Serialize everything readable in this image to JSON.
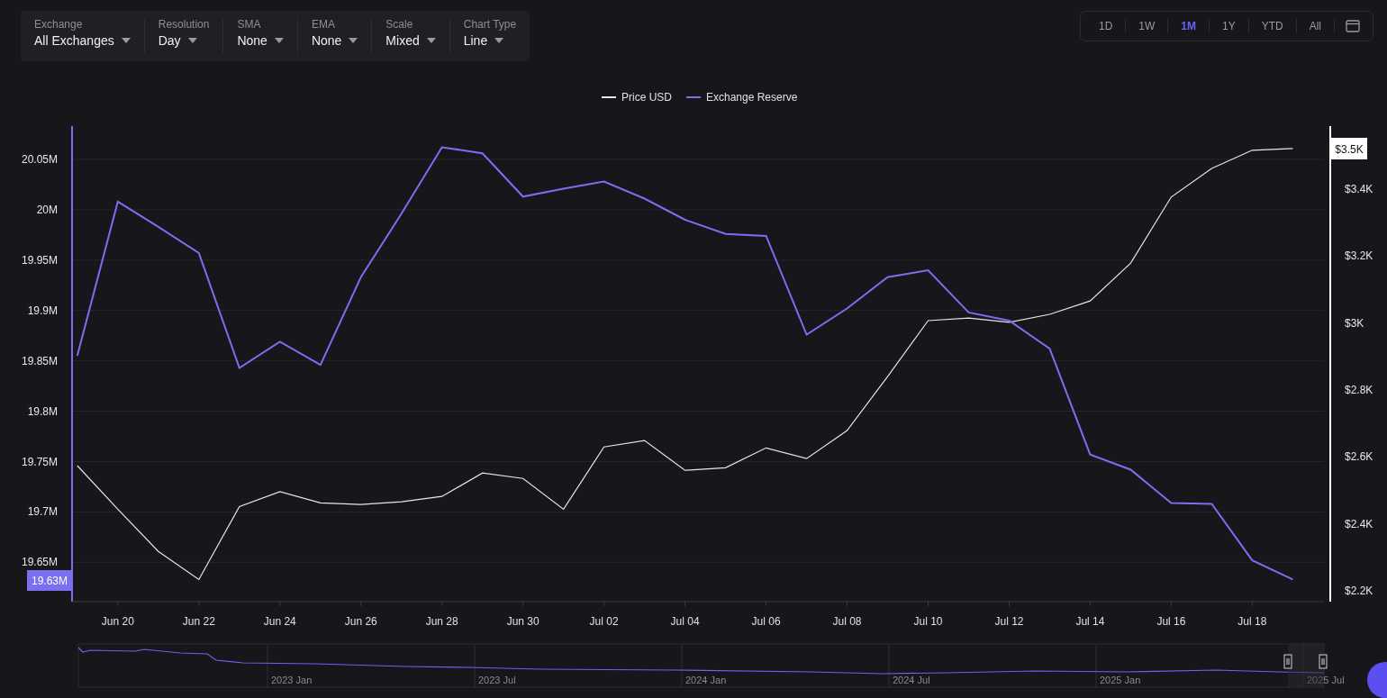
{
  "filters": [
    {
      "label": "Exchange",
      "value": "All Exchanges"
    },
    {
      "label": "Resolution",
      "value": "Day"
    },
    {
      "label": "SMA",
      "value": "None"
    },
    {
      "label": "EMA",
      "value": "None"
    },
    {
      "label": "Scale",
      "value": "Mixed"
    },
    {
      "label": "Chart Type",
      "value": "Line"
    }
  ],
  "ranges": [
    {
      "label": "1D",
      "selected": false
    },
    {
      "label": "1W",
      "selected": false
    },
    {
      "label": "1M",
      "selected": true
    },
    {
      "label": "1Y",
      "selected": false
    },
    {
      "label": "YTD",
      "selected": false
    },
    {
      "label": "All",
      "selected": false
    }
  ],
  "chart": {
    "chart_data": {
      "type": "line",
      "grid": true,
      "legend": "top",
      "categories": [
        null,
        "Jun 20",
        null,
        "Jun 22",
        null,
        "Jun 24",
        null,
        "Jun 26",
        null,
        "Jun 28",
        null,
        "Jun 30",
        null,
        "Jul 02",
        null,
        "Jul 04",
        null,
        "Jul 06",
        null,
        "Jul 08",
        null,
        "Jul 10",
        null,
        "Jul 12",
        null,
        "Jul 14",
        null,
        "Jul 16",
        null,
        "Jul 18",
        null
      ],
      "series": [
        {
          "name": "Price USD",
          "color": "#e6e6e6",
          "axis": "y2",
          "values": [
            2574,
            2444,
            2318,
            2234,
            2452,
            2496,
            2463,
            2458,
            2466,
            2482,
            2552,
            2536,
            2444,
            2630,
            2649,
            2560,
            2568,
            2627,
            2595,
            2679,
            2840,
            3007,
            3015,
            3002,
            3026,
            3066,
            3179,
            3376,
            3462,
            3516,
            3521
          ]
        },
        {
          "name": "Exchange Reserve",
          "color": "#7b6ff0",
          "values": [
            19.855,
            20.008,
            19.983,
            19.957,
            19.843,
            19.869,
            19.846,
            19.933,
            19.996,
            20.062,
            20.056,
            20.013,
            20.021,
            20.028,
            20.011,
            19.99,
            19.976,
            19.974,
            19.876,
            19.902,
            19.933,
            19.94,
            19.898,
            19.89,
            19.862,
            19.757,
            19.742,
            19.709,
            19.708,
            19.652,
            19.633
          ]
        }
      ],
      "ylim": [
        19.611,
        20.083
      ],
      "yticks": [
        {
          "value": 19.65,
          "label": "19.65M"
        },
        {
          "value": 19.7,
          "label": "19.7M"
        },
        {
          "value": 19.75,
          "label": "19.75M"
        },
        {
          "value": 19.8,
          "label": "19.8M"
        },
        {
          "value": 19.85,
          "label": "19.85M"
        },
        {
          "value": 19.9,
          "label": "19.9M"
        },
        {
          "value": 19.95,
          "label": "19.95M"
        },
        {
          "value": 20.0,
          "label": "20M"
        },
        {
          "value": 20.05,
          "label": "20.05M"
        }
      ],
      "y2lim": [
        2168,
        3588
      ],
      "y2ticks": [
        {
          "value": 2200,
          "label": "$2.2K"
        },
        {
          "value": 2400,
          "label": "$2.4K"
        },
        {
          "value": 2600,
          "label": "$2.6K"
        },
        {
          "value": 2800,
          "label": "$2.8K"
        },
        {
          "value": 3000,
          "label": "$3K"
        },
        {
          "value": 3200,
          "label": "$3.2K"
        },
        {
          "value": 3400,
          "label": "$3.4K"
        }
      ]
    },
    "cursor": {
      "left_label": "19.63M",
      "right_label": "$3.5K"
    }
  },
  "navigator": {
    "labels": [
      "2023 Jan",
      "2023 Jul",
      "2024 Jan",
      "2024 Jul",
      "2025 Jan",
      "2025 Jul"
    ]
  }
}
